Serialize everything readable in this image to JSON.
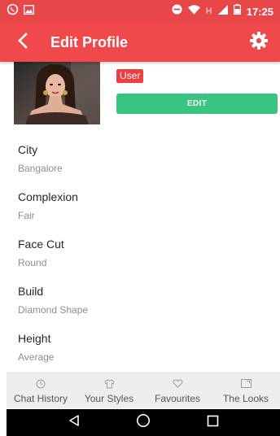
{
  "status_bar": {
    "time": "17:25",
    "network_letter": "H"
  },
  "toolbar": {
    "title": "Edit Profile",
    "back_icon": "chevron-left-icon",
    "settings_icon": "gear-icon"
  },
  "profile": {
    "role_badge": "User",
    "edit_label": "EDIT"
  },
  "fields": [
    {
      "label": "City",
      "value": "Bangalore"
    },
    {
      "label": "Complexion",
      "value": "Fair"
    },
    {
      "label": "Face Cut",
      "value": "Round"
    },
    {
      "label": "Build",
      "value": "Diamond Shape"
    },
    {
      "label": "Height",
      "value": "Average"
    }
  ],
  "bottom_tabs": [
    {
      "label": "Chat History",
      "icon": "clock-icon"
    },
    {
      "label": "Your Styles",
      "icon": "shirt-icon"
    },
    {
      "label": "Favourites",
      "icon": "heart-icon"
    },
    {
      "label": "The Looks",
      "icon": "picture-icon"
    }
  ],
  "colors": {
    "toolbar": "#f0494c",
    "status_bar": "#e8474a",
    "badge": "#ee3d43",
    "edit_button": "#39c481"
  }
}
